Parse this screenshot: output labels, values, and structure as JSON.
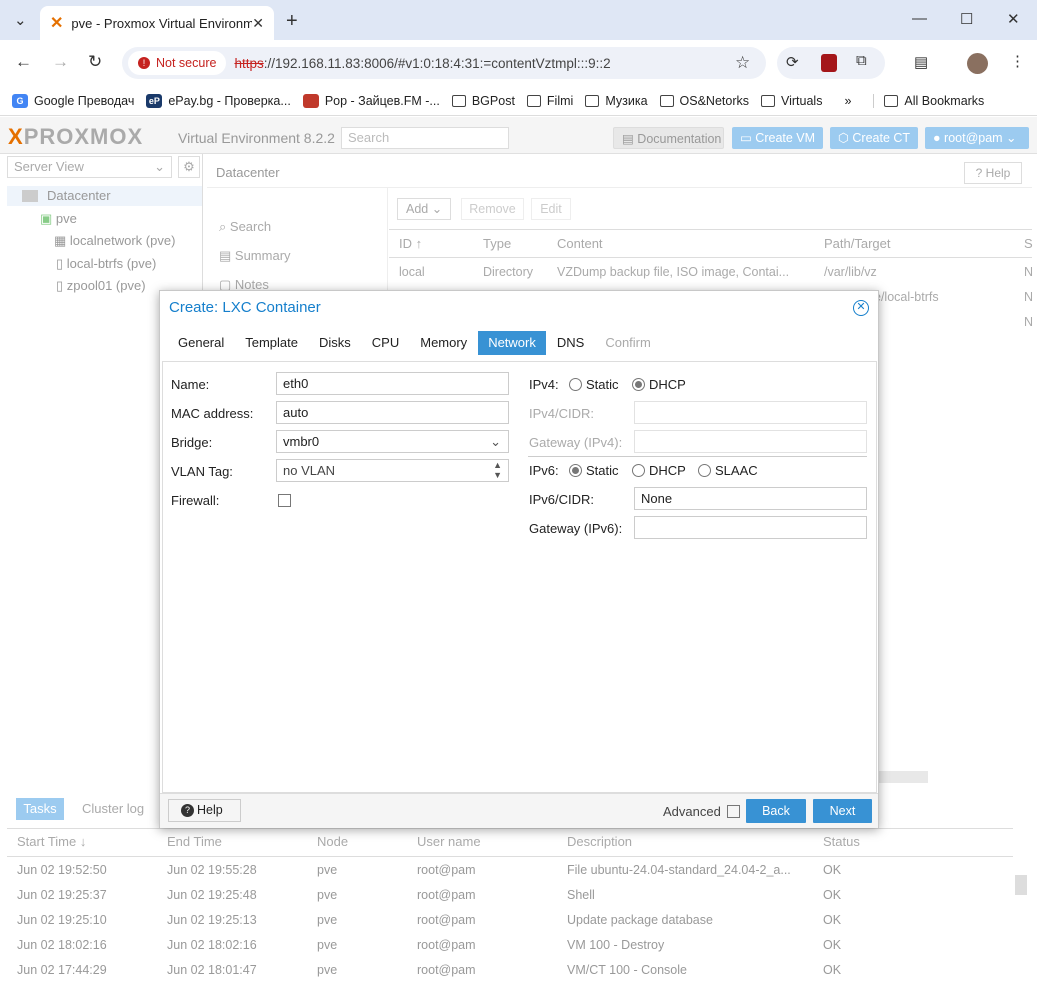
{
  "browser": {
    "tab_title": "pve - Proxmox Virtual Environm",
    "not_secure": "Not secure",
    "url_scheme": "https",
    "url_rest": "://192.168.11.83:8006/#v1:0:18:4:31:=contentVztmpl:::9::2",
    "bookmarks": [
      "Google Преводач",
      "ePay.bg - Проверка...",
      "Pop - Зайцев.FM -...",
      "BGPost",
      "Filmi",
      "Музика",
      "OS&Netorks",
      "Virtuals"
    ],
    "more": "»",
    "all_bookmarks": "All Bookmarks"
  },
  "header": {
    "logo_a": "X",
    "logo_b": "PROXMOX",
    "version": "Virtual Environment 8.2.2",
    "search_placeholder": "Search",
    "documentation": "Documentation",
    "create_vm": "Create VM",
    "create_ct": "Create CT",
    "user": "root@pam"
  },
  "left": {
    "view": "Server View",
    "datacenter": "Datacenter",
    "node": "pve",
    "items": [
      "localnetwork (pve)",
      "local-btrfs (pve)",
      "zpool01 (pve)"
    ]
  },
  "main": {
    "title": "Datacenter",
    "help": "Help",
    "nav": [
      "Search",
      "Summary",
      "Notes"
    ],
    "toolbar": [
      "Add",
      "Remove",
      "Edit"
    ],
    "columns": [
      "ID ↑",
      "Type",
      "Content",
      "Path/Target",
      "S"
    ],
    "rows": [
      [
        "local",
        "Directory",
        "VZDump backup file, ISO image, Contai...",
        "/var/lib/vz",
        "N"
      ],
      [
        "",
        "",
        "",
        "e/local-btrfs",
        "N"
      ],
      [
        "",
        "",
        "",
        "",
        "N"
      ]
    ]
  },
  "bottom": {
    "tabs": [
      "Tasks",
      "Cluster log"
    ],
    "columns": [
      "Start Time ↓",
      "End Time",
      "Node",
      "User name",
      "Description",
      "Status"
    ],
    "rows": [
      [
        "Jun 02 19:52:50",
        "Jun 02 19:55:28",
        "pve",
        "root@pam",
        "File ubuntu-24.04-standard_24.04-2_a...",
        "OK"
      ],
      [
        "Jun 02 19:25:37",
        "Jun 02 19:25:48",
        "pve",
        "root@pam",
        "Shell",
        "OK"
      ],
      [
        "Jun 02 19:25:10",
        "Jun 02 19:25:13",
        "pve",
        "root@pam",
        "Update package database",
        "OK"
      ],
      [
        "Jun 02 18:02:16",
        "Jun 02 18:02:16",
        "pve",
        "root@pam",
        "VM 100 - Destroy",
        "OK"
      ],
      [
        "Jun 02 17:44:29",
        "Jun 02 18:01:47",
        "pve",
        "root@pam",
        "VM/CT 100 - Console",
        "OK"
      ]
    ]
  },
  "dialog": {
    "title": "Create: LXC Container",
    "tabs": [
      "General",
      "Template",
      "Disks",
      "CPU",
      "Memory",
      "Network",
      "DNS",
      "Confirm"
    ],
    "name_label": "Name:",
    "name_value": "eth0",
    "mac_label": "MAC address:",
    "mac_value": "auto",
    "bridge_label": "Bridge:",
    "bridge_value": "vmbr0",
    "vlan_label": "VLAN Tag:",
    "vlan_value": "no VLAN",
    "firewall_label": "Firewall:",
    "ipv4_label": "IPv4:",
    "static": "Static",
    "dhcp": "DHCP",
    "slaac": "SLAAC",
    "ipv4cidr_label": "IPv4/CIDR:",
    "gw4_label": "Gateway (IPv4):",
    "ipv6_label": "IPv6:",
    "ipv6cidr_label": "IPv6/CIDR:",
    "ipv6cidr_value": "None",
    "gw6_label": "Gateway (IPv6):",
    "help": "Help",
    "advanced": "Advanced",
    "back": "Back",
    "next": "Next"
  }
}
